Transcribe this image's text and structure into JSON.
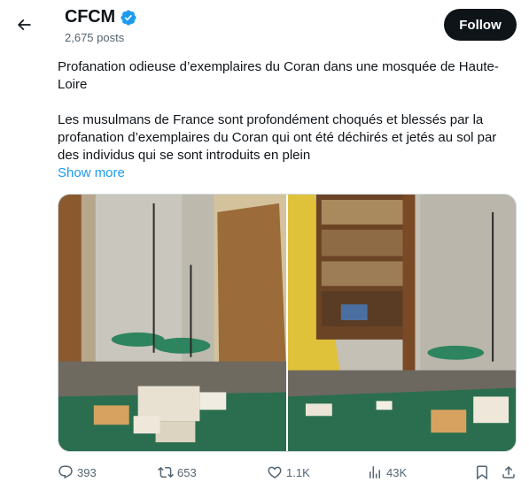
{
  "header": {
    "account_name": "CFCM",
    "posts_count": "2,675 posts",
    "follow_label": "Follow"
  },
  "post": {
    "paragraph_1": "Profanation odieuse d’exemplaires du Coran dans une mosquée de Haute-Loire",
    "paragraph_2": "Les musulmans de France sont profondément choqués et blessés par la profanation d’exemplaires du Coran qui ont été déchirés et jetés au sol par des individus qui se sont introduits en plein",
    "show_more": "Show more"
  },
  "actions": {
    "replies": "393",
    "reposts": "653",
    "likes": "1.1K",
    "views": "43K"
  },
  "colors": {
    "accent": "#1d9bf0",
    "text_primary": "#0f1419",
    "text_secondary": "#536471",
    "follow_bg": "#0f1419"
  },
  "icons": [
    "back-arrow-icon",
    "verified-badge-icon",
    "reply-icon",
    "repost-icon",
    "like-icon",
    "views-icon",
    "bookmark-icon",
    "share-icon"
  ]
}
